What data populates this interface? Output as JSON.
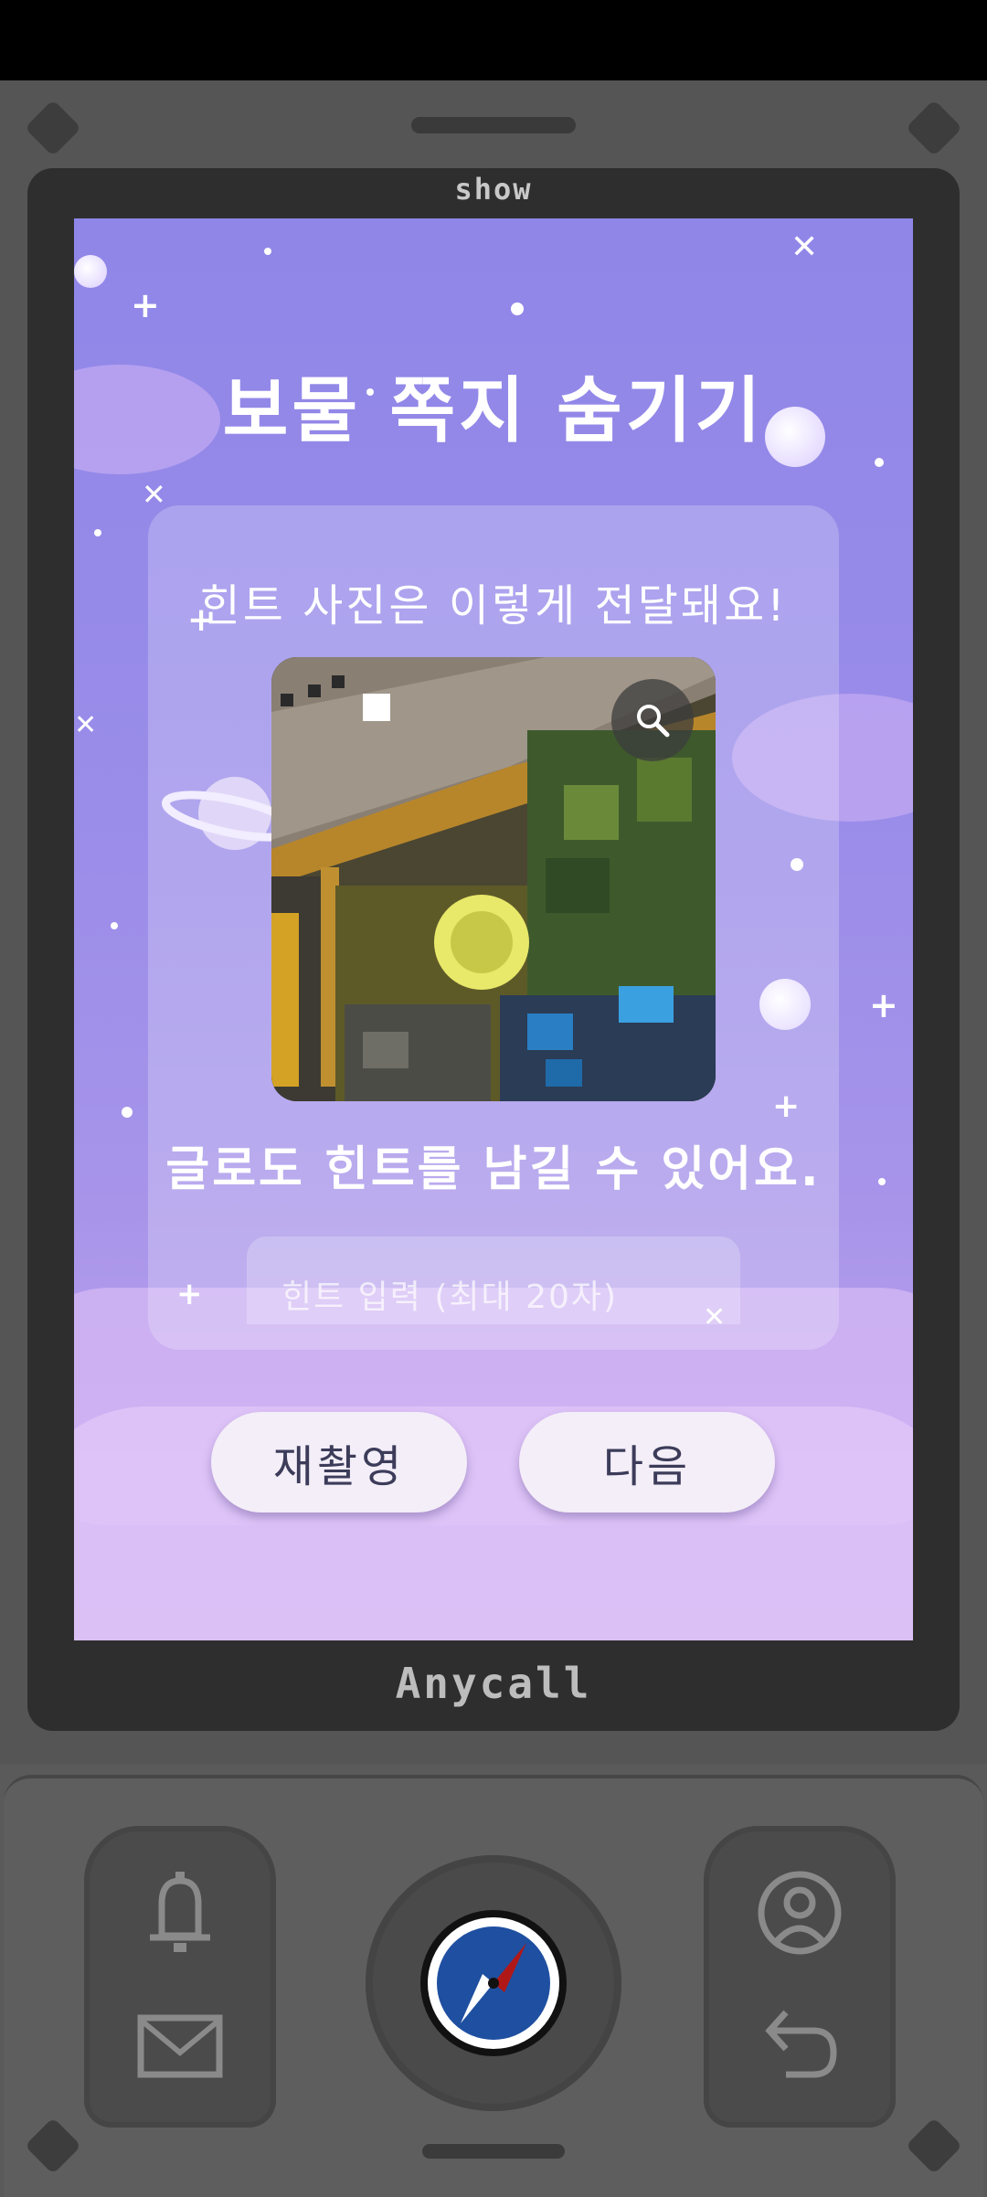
{
  "device": {
    "top_label": "show",
    "brand": "Anycall"
  },
  "screen": {
    "title": "보물 쪽지 숨기기",
    "card": {
      "photo_caption": "힌트 사진은 이렇게 전달돼요!",
      "text_hint_title": "글로도 힌트를 남길 수 있어요.",
      "hint_input_placeholder": "힌트 입력 (최대 20자)",
      "hint_input_value": ""
    },
    "buttons": {
      "retake_label": "재촬영",
      "next_label": "다음"
    }
  },
  "bottom_panel": {
    "left_icons": [
      "bell-icon",
      "mail-icon"
    ],
    "center_icon": "compass-icon",
    "right_icons": [
      "profile-icon",
      "back-arrow-icon"
    ]
  },
  "colors": {
    "screen_top": "#8f86e8",
    "screen_bottom": "#c7a8f0",
    "button_bg": "#f4eef8",
    "device_body": "#555555",
    "compass_blue": "#1f4fa0",
    "compass_red": "#b01818"
  }
}
